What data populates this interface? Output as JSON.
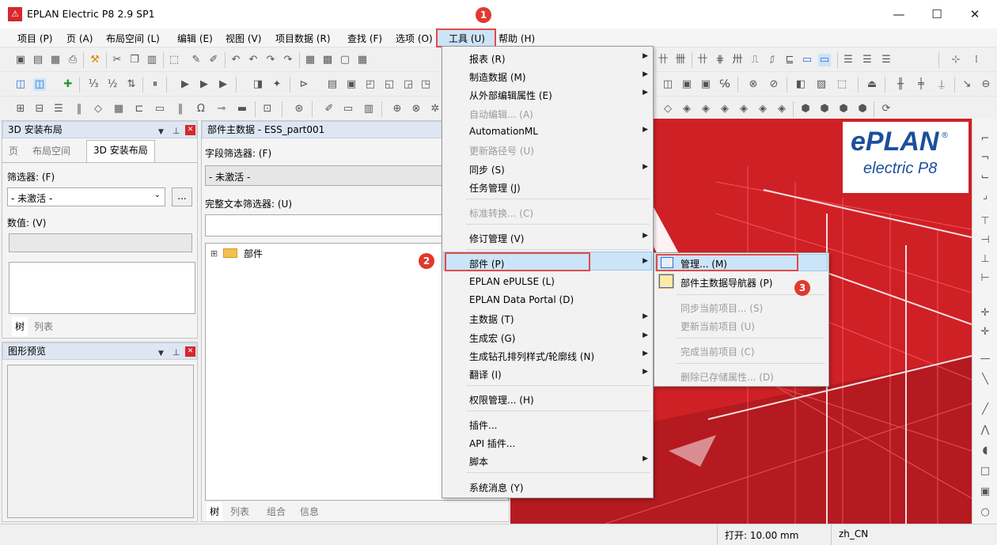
{
  "window": {
    "title": "EPLAN Electric P8 2.9 SP1",
    "logo_glyph": "⚠",
    "minimize": "—",
    "maximize": "☐",
    "close": "✕"
  },
  "menubar": [
    "项目 (P)",
    "页 (A)",
    "布局空间 (L)",
    "编辑 (E)",
    "视图 (V)",
    "项目数据 (R)",
    "查找 (F)",
    "选项 (O)",
    "工具 (U)",
    "帮助 (H)"
  ],
  "left_panel": {
    "title": "3D 安装布局",
    "tabs": [
      "页",
      "布局空间",
      "3D 安装布局"
    ],
    "filter_label": "筛选器: (F)",
    "filter_value": "- 未激活 -",
    "more_btn": "...",
    "value_label": "数值: (V)",
    "bottom_tabs": [
      "树",
      "列表"
    ]
  },
  "preview_panel": {
    "title": "图形预览"
  },
  "parts_panel": {
    "title": "部件主数据 - ESS_part001",
    "field_filter_label": "字段筛选器: (F)",
    "field_filter_value": "- 未激活 -",
    "fulltext_label": "完整文本筛选器: (U)",
    "tree_root": "部件",
    "tree_expander": "⊞",
    "bottom_tabs": [
      "树",
      "列表",
      "组合",
      "信息"
    ]
  },
  "tools_menu": [
    {
      "label": "报表 (R)",
      "sub": true,
      "disabled": false
    },
    {
      "label": "制造数据 (M)",
      "sub": true,
      "disabled": false
    },
    {
      "label": "从外部编辑属性 (E)",
      "sub": true,
      "disabled": false
    },
    {
      "label": "自动编辑... (A)",
      "sub": false,
      "disabled": true
    },
    {
      "label": "AutomationML",
      "sub": true,
      "disabled": false
    },
    {
      "label": "更新路径号 (U)",
      "sub": false,
      "disabled": true
    },
    {
      "label": "同步 (S)",
      "sub": true,
      "disabled": false
    },
    {
      "label": "任务管理 (J)",
      "sub": false,
      "disabled": false
    },
    {
      "label": "标准转换... (C)",
      "sub": false,
      "disabled": true
    },
    {
      "label": "修订管理 (V)",
      "sub": true,
      "disabled": false
    },
    {
      "label": "部件 (P)",
      "sub": true,
      "disabled": false
    },
    {
      "label": "EPLAN ePULSE (L)",
      "sub": false,
      "disabled": false
    },
    {
      "label": "EPLAN Data Portal (D)",
      "sub": false,
      "disabled": false
    },
    {
      "label": "主数据 (T)",
      "sub": true,
      "disabled": false
    },
    {
      "label": "生成宏 (G)",
      "sub": true,
      "disabled": false
    },
    {
      "label": "生成钻孔排列样式/轮廓线 (N)",
      "sub": true,
      "disabled": false
    },
    {
      "label": "翻译 (I)",
      "sub": true,
      "disabled": false
    },
    {
      "label": "权限管理... (H)",
      "sub": false,
      "disabled": false
    },
    {
      "label": "插件...",
      "sub": false,
      "disabled": false
    },
    {
      "label": "API 插件...",
      "sub": false,
      "disabled": false
    },
    {
      "label": "脚本",
      "sub": true,
      "disabled": false
    },
    {
      "label": "系统消息 (Y)",
      "sub": false,
      "disabled": false
    }
  ],
  "parts_submenu": [
    {
      "label": "管理... (M)",
      "disabled": false
    },
    {
      "label": "部件主数据导航器 (P)",
      "disabled": false
    },
    {
      "label": "同步当前项目... (S)",
      "disabled": true
    },
    {
      "label": "更新当前项目 (U)",
      "disabled": true
    },
    {
      "label": "完成当前项目 (C)",
      "disabled": true
    },
    {
      "label": "删除已存储属性... (D)",
      "disabled": true
    }
  ],
  "badges": [
    "1",
    "2",
    "3"
  ],
  "splash": {
    "brand_top": "ePLAN",
    "brand_bottom": "electric P8",
    "brand_mark": "®"
  },
  "statusbar": {
    "grid": "打开: 10.00 mm",
    "lang": "zh_CN"
  },
  "colors": {
    "brand_red": "#cf2026",
    "highlight_red": "#e14b4b",
    "menu_highlight": "#cce4f7"
  }
}
